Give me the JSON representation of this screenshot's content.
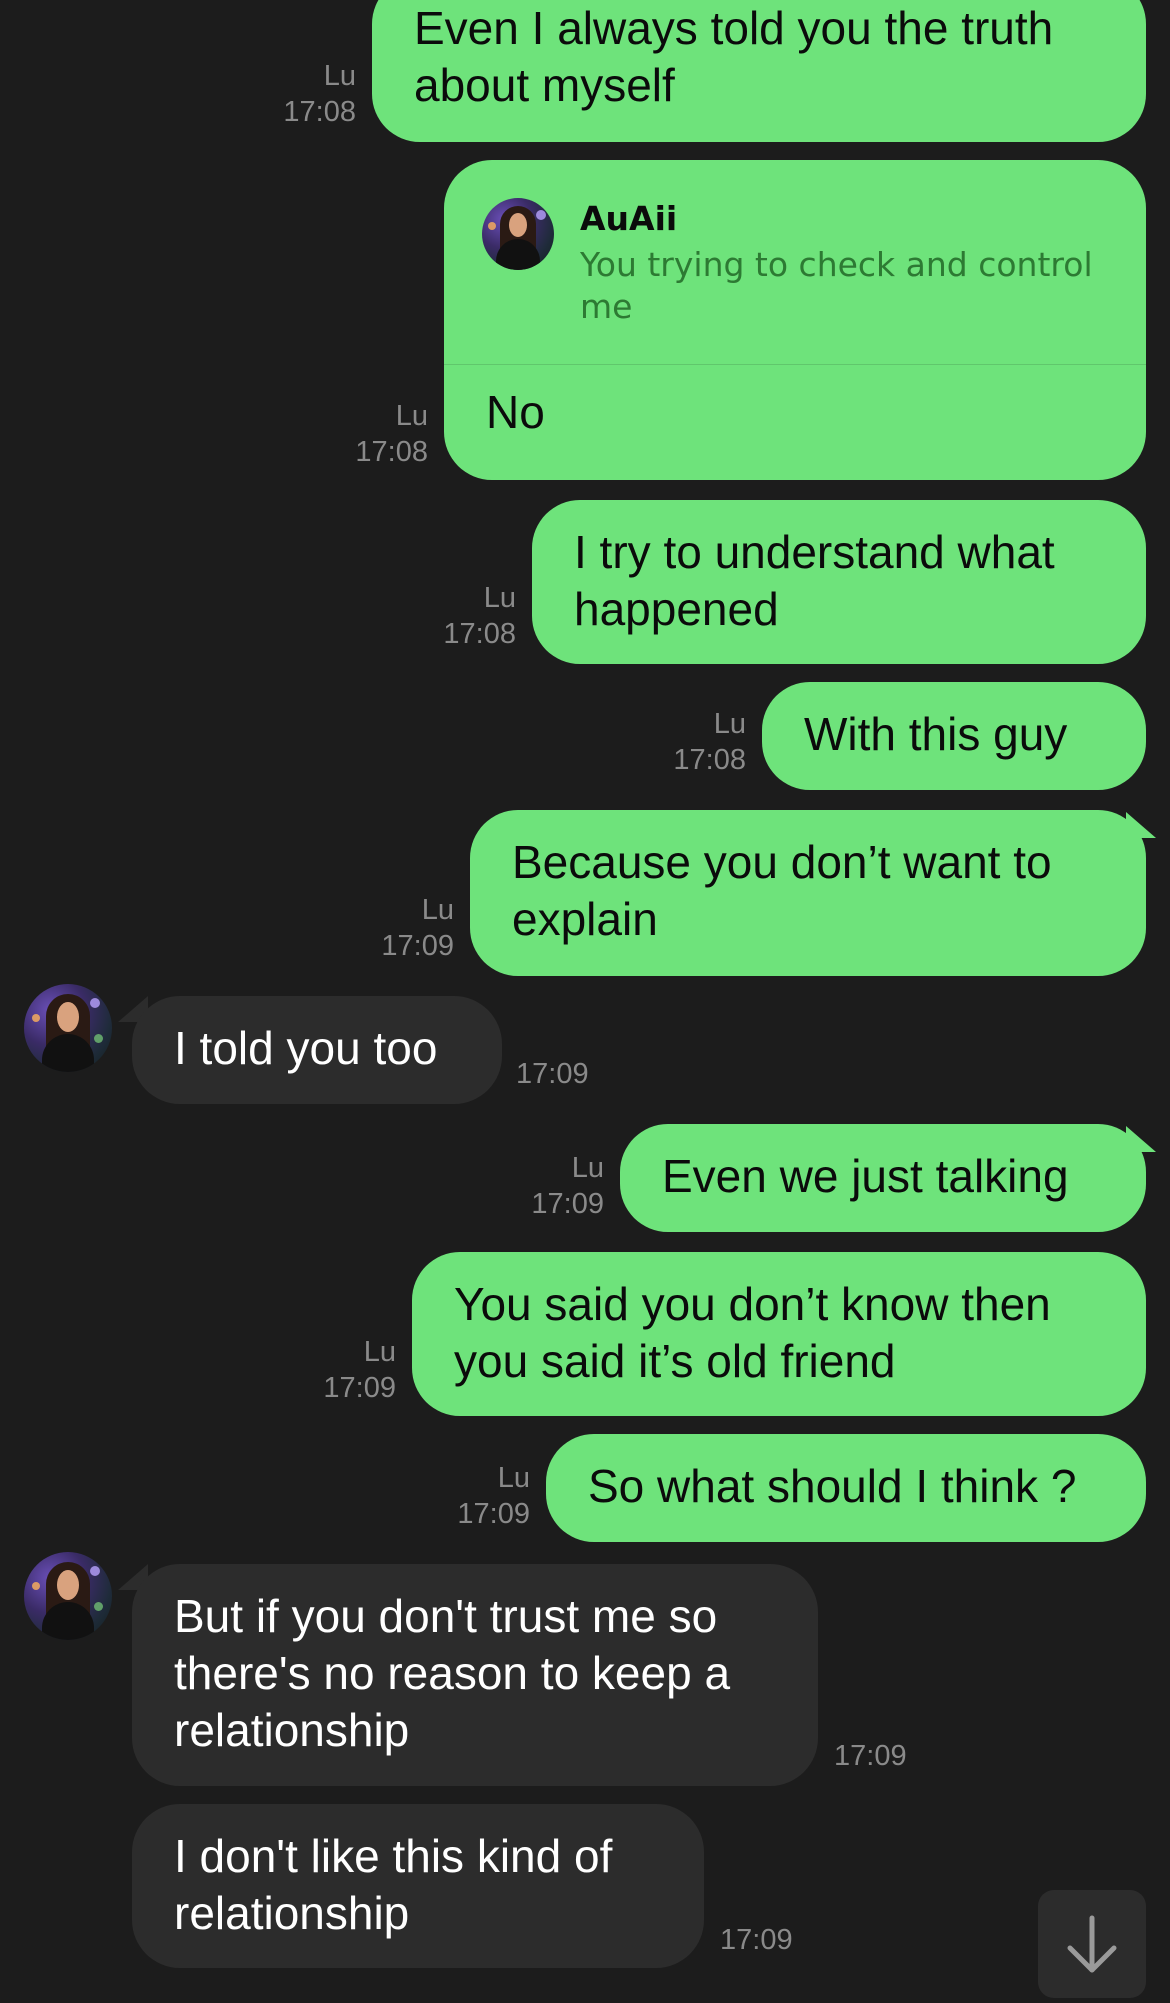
{
  "sender_label": "Lu",
  "messages_out": [
    {
      "text": "Even I always told you the truth\nabout myself",
      "time": "17:08"
    },
    {
      "reply_to": {
        "name": "AuAii",
        "text": "You trying to check and control me"
      },
      "text": "No",
      "time": "17:08"
    },
    {
      "text": "I try to understand what\nhappened",
      "time": "17:08"
    },
    {
      "text": "With this guy",
      "time": "17:08"
    },
    {
      "text": "Because you don’t want to\nexplain",
      "time": "17:09"
    },
    {
      "text": "Even we just talking",
      "time": "17:09"
    },
    {
      "text": "You said you don’t know then\nyou said it’s old friend",
      "time": "17:09"
    },
    {
      "text": "So what should I think ?",
      "time": "17:09"
    }
  ],
  "messages_in": [
    {
      "text": "I told you too",
      "time": "17:09"
    },
    {
      "text": "But if you don't trust me so\nthere's no reason to keep a\nrelationship",
      "time": "17:09"
    },
    {
      "text": "I don't like this kind of\nrelationship",
      "time": "17:09"
    }
  ],
  "scroll_button": {
    "icon": "arrow-down-icon"
  },
  "colors": {
    "background": "#1c1c1c",
    "outgoing_bubble": "#6ee37b",
    "incoming_bubble": "#2c2c2c",
    "reply_text": "#2d7a33",
    "meta_text": "#8a8a8a"
  }
}
